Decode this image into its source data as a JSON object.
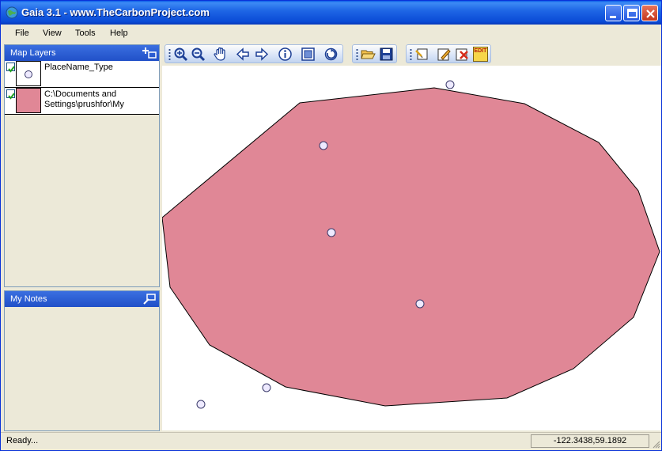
{
  "window": {
    "title": "Gaia 3.1 - www.TheCarbonProject.com"
  },
  "menu": [
    {
      "label": "File"
    },
    {
      "label": "View"
    },
    {
      "label": "Tools"
    },
    {
      "label": "Help"
    }
  ],
  "layers_panel": {
    "title": "Map Layers",
    "layers": [
      {
        "name": "PlaceName_Type",
        "checked": true,
        "swatch": "point"
      },
      {
        "name": "C:\\Documents and Settings\\prushfor\\My",
        "checked": true,
        "swatch": "polygon"
      }
    ]
  },
  "notes_panel": {
    "title": "My Notes"
  },
  "toolbar": {
    "tools": [
      {
        "icon": "zoom-in-icon"
      },
      {
        "icon": "zoom-out-icon"
      },
      {
        "icon": "pan-hand-icon"
      },
      {
        "icon": "back-arrow-icon"
      },
      {
        "icon": "forward-arrow-icon"
      },
      {
        "icon": "info-icon"
      },
      {
        "icon": "full-extent-icon"
      },
      {
        "icon": "refresh-icon"
      },
      {
        "icon": "open-folder-icon"
      },
      {
        "icon": "save-disk-icon"
      },
      {
        "icon": "new-note-icon"
      },
      {
        "icon": "edit-pencil-icon"
      },
      {
        "icon": "delete-x-icon"
      },
      {
        "icon": "edit-label-icon",
        "text": "EDIT"
      }
    ]
  },
  "colors": {
    "polygon_fill": "#e08796",
    "point_fill": "#eeeaff",
    "title_blue": "#0a4bd6"
  },
  "status": {
    "text": "Ready...",
    "coordinates": "-122.3438,59.1892"
  }
}
